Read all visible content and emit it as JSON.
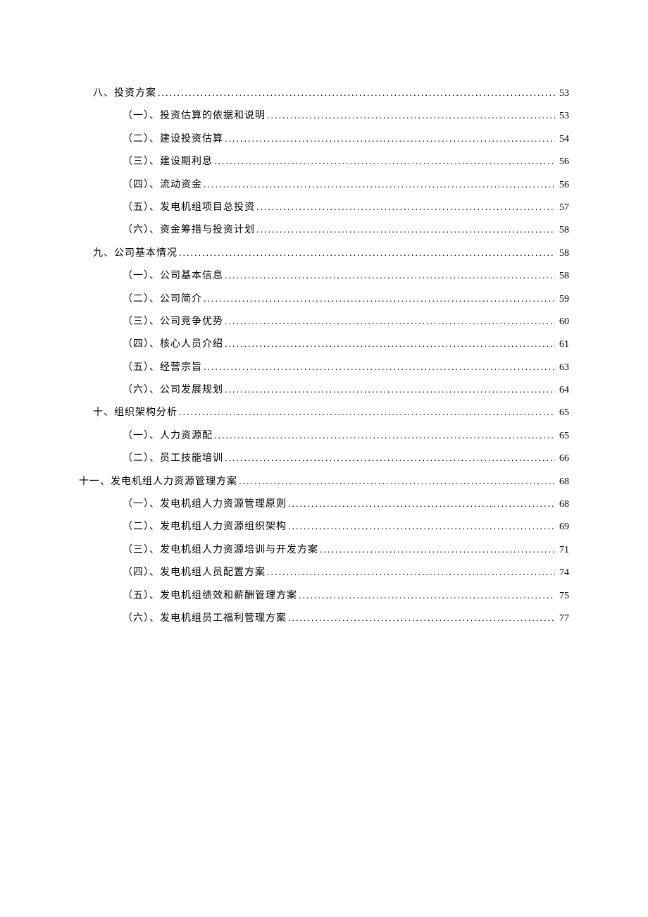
{
  "toc": [
    {
      "level": 1,
      "title": "八、投资方案",
      "page": "53"
    },
    {
      "level": 2,
      "title": "（一）、投资估算的依据和说明",
      "page": "53"
    },
    {
      "level": 2,
      "title": "（二）、建设投资估算",
      "page": "54"
    },
    {
      "level": 2,
      "title": "（三）、建设期利息",
      "page": "56"
    },
    {
      "level": 2,
      "title": "（四）、流动资金",
      "page": "56"
    },
    {
      "level": 2,
      "title": "（五）、发电机组项目总投资",
      "page": "57"
    },
    {
      "level": 2,
      "title": "（六）、资金筹措与投资计划",
      "page": "58"
    },
    {
      "level": 1,
      "title": "九、公司基本情况",
      "page": "58"
    },
    {
      "level": 2,
      "title": "（一）、公司基本信息",
      "page": "58"
    },
    {
      "level": 2,
      "title": "（二）、公司简介",
      "page": "59"
    },
    {
      "level": 2,
      "title": "（三）、公司竞争优势",
      "page": "60"
    },
    {
      "level": 2,
      "title": "（四）、核心人员介绍",
      "page": "61"
    },
    {
      "level": 2,
      "title": "（五）、经营宗旨",
      "page": "63"
    },
    {
      "level": 2,
      "title": "（六）、公司发展规划",
      "page": "64"
    },
    {
      "level": 1,
      "title": "十、组织架构分析",
      "page": "65"
    },
    {
      "level": 2,
      "title": "（一）、人力资源配",
      "page": "65"
    },
    {
      "level": 2,
      "title": "（二）、员工技能培训",
      "page": "66"
    },
    {
      "level": 1,
      "title": "十一、发电机组人力资源管理方案",
      "page": "68",
      "alt": true
    },
    {
      "level": 2,
      "title": "（一）、发电机组人力资源管理原则",
      "page": "68"
    },
    {
      "level": 2,
      "title": "（二）、发电机组人力资源组织架构",
      "page": "69"
    },
    {
      "level": 2,
      "title": "（三）、发电机组人力资源培训与开发方案",
      "page": "71"
    },
    {
      "level": 2,
      "title": "（四）、发电机组人员配置方案",
      "page": "74"
    },
    {
      "level": 2,
      "title": "（五）、发电机组绩效和薪酬管理方案",
      "page": "75"
    },
    {
      "level": 2,
      "title": "（六）、发电机组员工福利管理方案",
      "page": "77"
    }
  ]
}
